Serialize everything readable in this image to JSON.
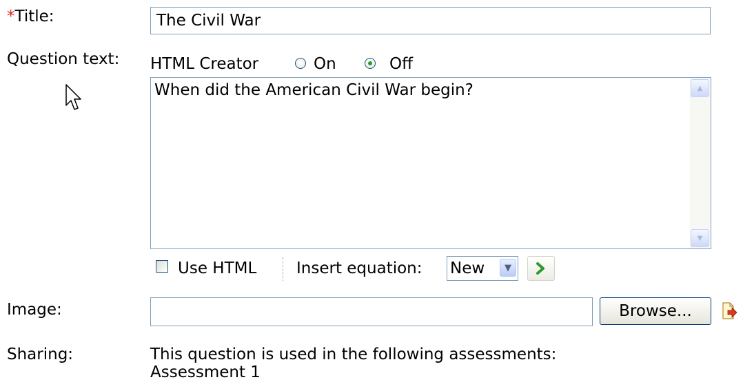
{
  "title_field": {
    "required_marker": "*",
    "label": "Title:",
    "value": "The Civil War"
  },
  "question_text": {
    "label": "Question text:",
    "html_creator_label": "HTML Creator",
    "options": [
      {
        "label": "On",
        "selected": false
      },
      {
        "label": "Off",
        "selected": true
      }
    ],
    "body": "When did the American Civil War begin?"
  },
  "editor_toolbar": {
    "use_html_label": "Use HTML",
    "use_html_checked": false,
    "insert_equation_label": "Insert equation:",
    "equation_selected": "New"
  },
  "image_field": {
    "label": "Image:",
    "value": "",
    "browse_label": "Browse..."
  },
  "sharing": {
    "label": "Sharing:",
    "text": "This question is used in the following assessments:",
    "assessment": "Assessment 1"
  },
  "colors": {
    "required": "#e02020",
    "input_border": "#7f9db9",
    "radio_dot": "#2d9a2d",
    "go_arrow": "#2e9a2e"
  },
  "icons": [
    "radio-button",
    "mouse-cursor-icon",
    "scroll-up-arrow-icon",
    "scroll-down-arrow-icon",
    "dropdown-arrow-icon",
    "go-arrow-icon",
    "remove-file-icon"
  ]
}
